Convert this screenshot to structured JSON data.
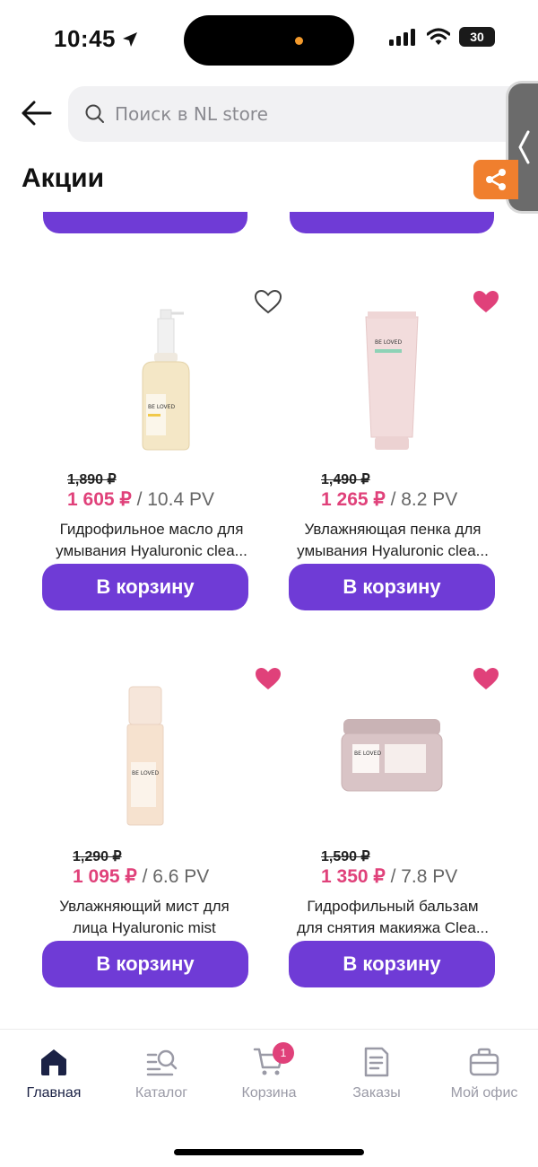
{
  "status_bar": {
    "time": "10:45",
    "battery": "30"
  },
  "search": {
    "placeholder": "Поиск в NL store"
  },
  "page": {
    "title": "Акции"
  },
  "products": [
    {
      "old_price": "1,890 ₽",
      "price": "1 605 ₽",
      "pv": " / 10.4 PV",
      "name_line1": "Гидрофильное масло для",
      "name_line2": "умывания Hyaluronic clea...",
      "button": "В корзину",
      "favorited": false,
      "brand": "BE LOVED"
    },
    {
      "old_price": "1,490 ₽",
      "price": "1 265 ₽",
      "pv": " / 8.2 PV",
      "name_line1": "Увлажняющая пенка для",
      "name_line2": "умывания Hyaluronic clea...",
      "button": "В корзину",
      "favorited": true,
      "brand": "BE LOVED"
    },
    {
      "old_price": "1,290 ₽",
      "price": "1 095 ₽",
      "pv": " / 6.6 PV",
      "name_line1": "Увлажняющий мист для",
      "name_line2": "лица Hyaluronic mist",
      "button": "В корзину",
      "favorited": true,
      "brand": "BE LOVED"
    },
    {
      "old_price": "1,590 ₽",
      "price": "1 350 ₽",
      "pv": " / 7.8 PV",
      "name_line1": "Гидрофильный бальзам",
      "name_line2": "для снятия макияжа Clea...",
      "button": "В корзину",
      "favorited": true,
      "brand": "BE LOVED"
    }
  ],
  "nav": {
    "items": [
      {
        "label": "Главная",
        "icon": "home-icon",
        "active": true
      },
      {
        "label": "Каталог",
        "icon": "catalog-search-icon",
        "active": false
      },
      {
        "label": "Корзина",
        "icon": "cart-icon",
        "active": false,
        "badge": "1"
      },
      {
        "label": "Заказы",
        "icon": "orders-icon",
        "active": false
      },
      {
        "label": "Мой офис",
        "icon": "briefcase-icon",
        "active": false
      }
    ]
  },
  "colors": {
    "accent": "#6f3bd6",
    "price": "#e0417a",
    "share": "#f07f2e",
    "nav_active": "#1b2245"
  }
}
